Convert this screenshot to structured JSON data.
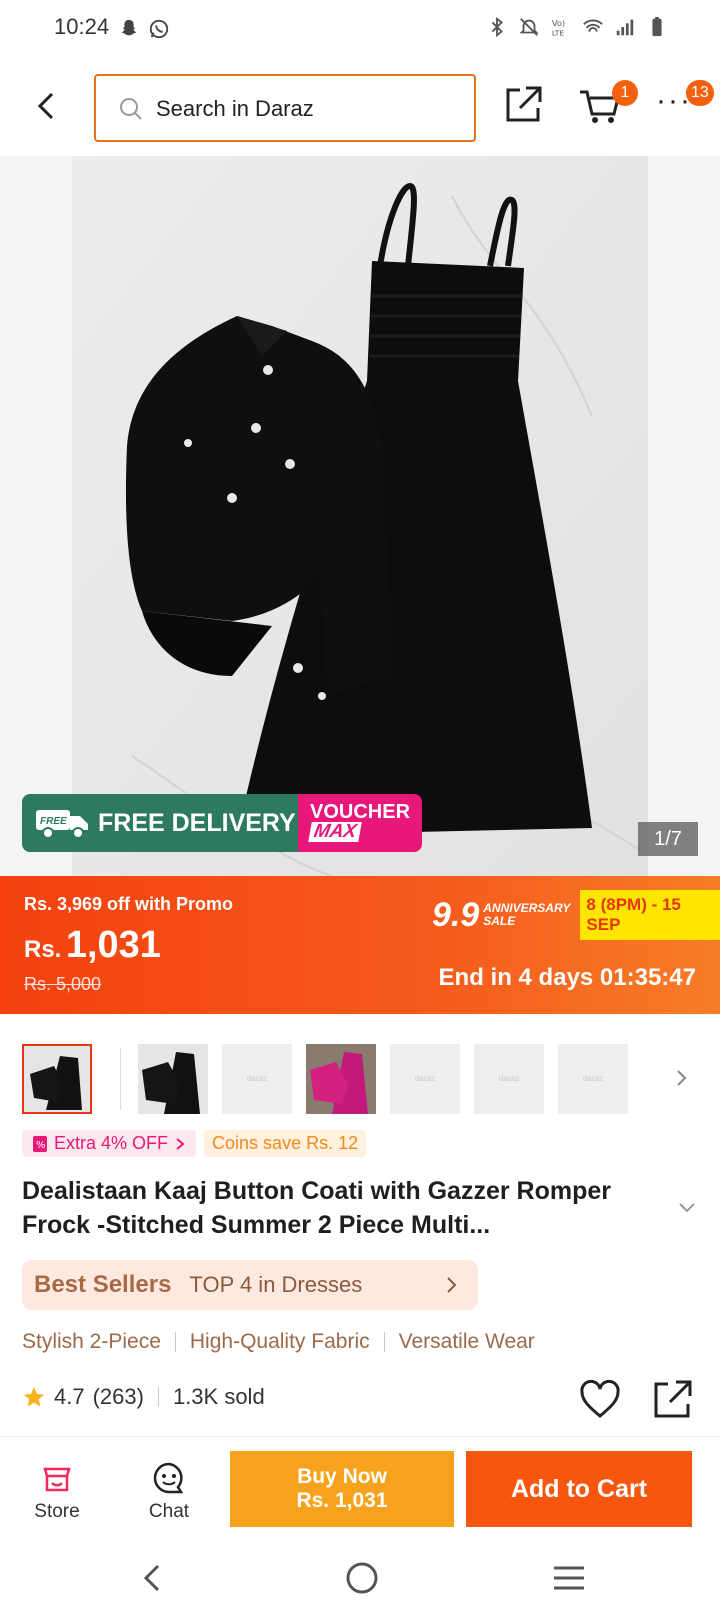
{
  "status_bar": {
    "time": "10:24"
  },
  "header": {
    "search_placeholder": "Search in Daraz",
    "cart_badge": "1",
    "more_badge": "13"
  },
  "hero": {
    "free_delivery": "FREE DELIVERY",
    "truck_label": "FREE",
    "voucher_line1": "VOUCHER",
    "voucher_line2": "MAX",
    "image_counter": "1/7"
  },
  "price": {
    "promo_text": "Rs. 3,969 off with Promo",
    "currency": "Rs.",
    "current": "1,031",
    "original": "Rs. 5,000",
    "sale_number": "9.9",
    "sale_line1": "ANNIVERSARY",
    "sale_line2": "SALE",
    "sale_dates": "8 (8PM) - 15 SEP",
    "countdown": "End in 4 days 01:35:47"
  },
  "thumbnails": {
    "placeholder_text": "daraz",
    "count": 8
  },
  "tags": {
    "extra_off": "Extra 4% OFF",
    "coins": "Coins save Rs. 12"
  },
  "product": {
    "title": "Dealistaan Kaaj Button Coati with Gazzer Romper Frock -Stitched Summer 2 Piece Multi..."
  },
  "best_seller": {
    "label": "Best Sellers",
    "rank": "TOP 4 in Dresses"
  },
  "highlights": [
    "Stylish 2-Piece",
    "High-Quality Fabric",
    "Versatile Wear"
  ],
  "rating": {
    "score": "4.7",
    "count": "(263)",
    "sold": "1.3K sold"
  },
  "action_bar": {
    "store": "Store",
    "chat": "Chat",
    "buy_now_line1": "Buy Now",
    "buy_now_line2": "Rs. 1,031",
    "add_to_cart": "Add to Cart"
  },
  "colors": {
    "brand_orange": "#f7560f",
    "buy_now": "#f7a21c",
    "free_delivery_green": "#2e7a60",
    "voucher_pink": "#e8187a"
  }
}
